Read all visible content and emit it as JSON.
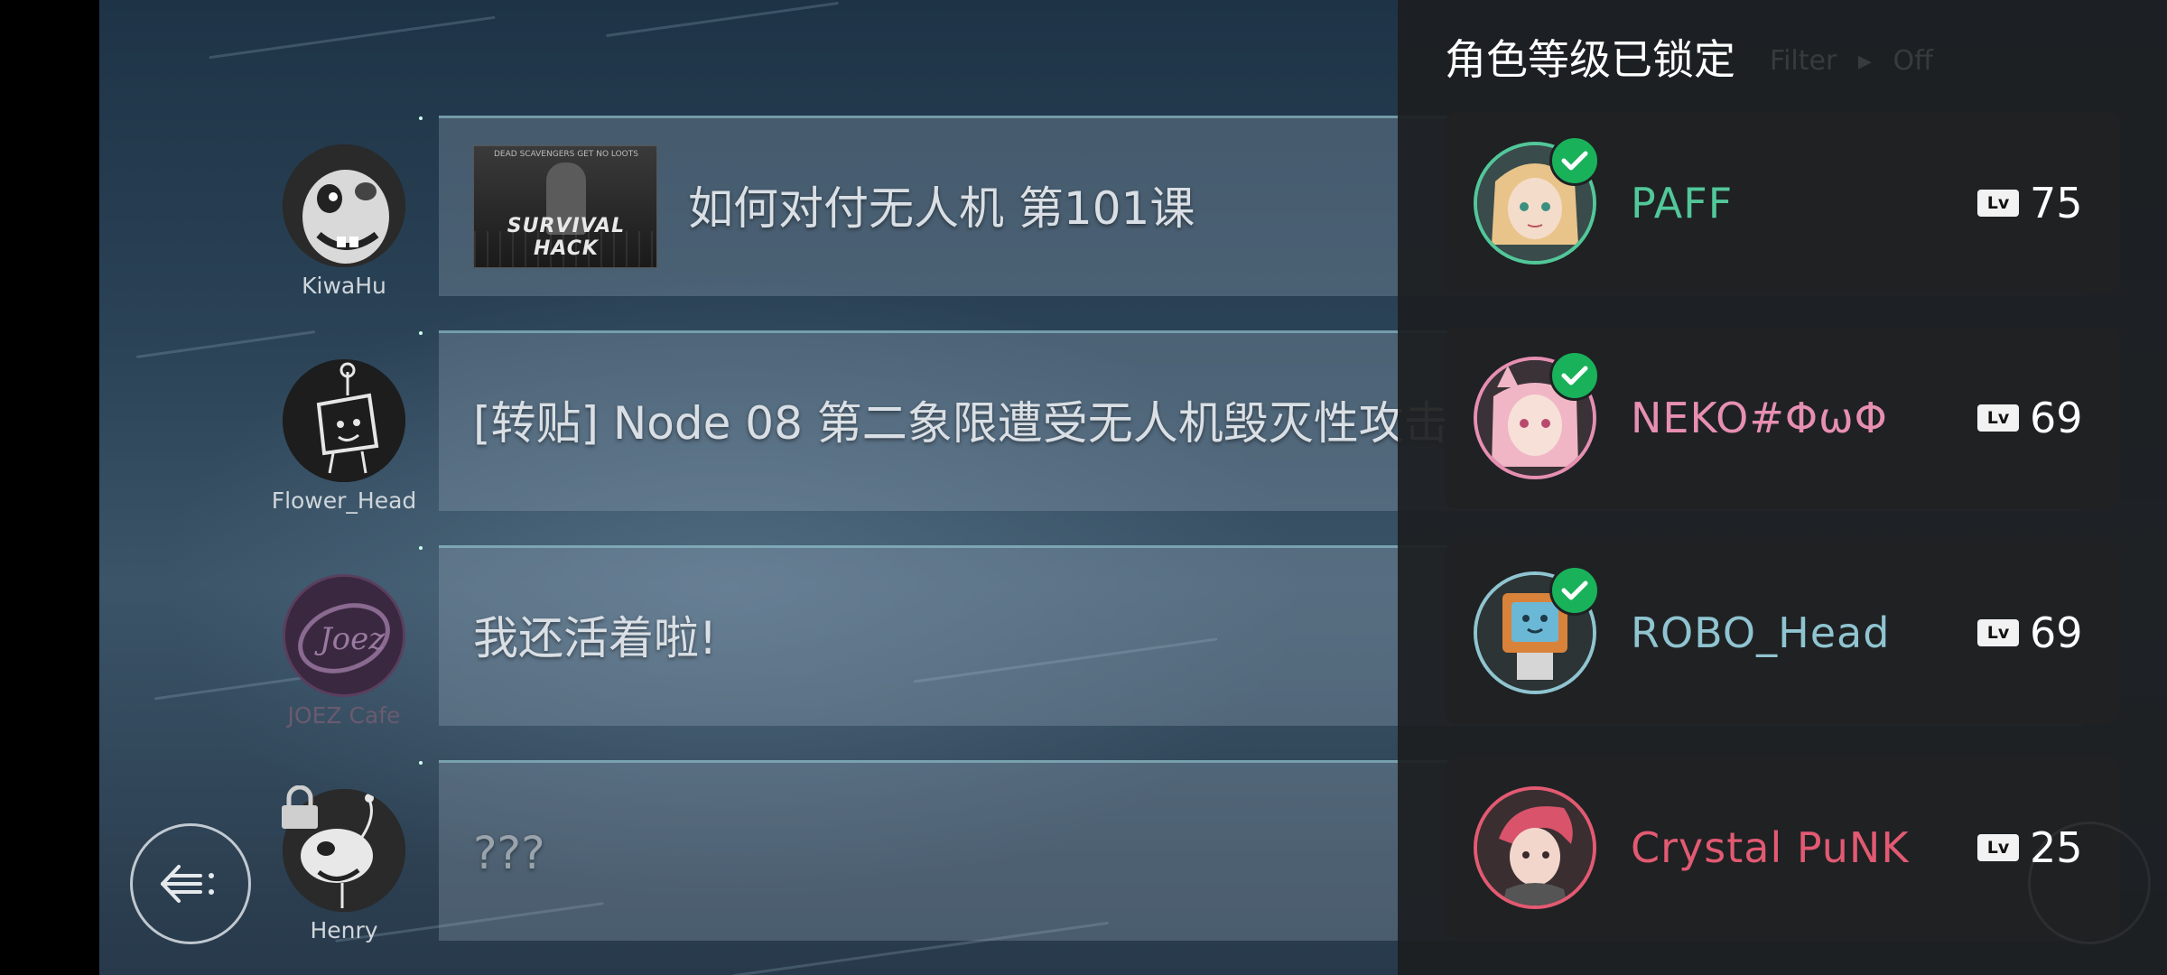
{
  "feed": {
    "posts": [
      {
        "author": "KiwaHu",
        "text": "如何对付无人机 第101课",
        "thumbnail": {
          "caption_small": "DEAD SCAVENGERS GET NO LOOTS",
          "caption_big": "SURVIVAL HACK"
        }
      },
      {
        "author": "Flower_Head",
        "text": "[转贴] Node 08 第二象限遭受无人机毁灭性攻击"
      },
      {
        "author": "JOEZ Cafe",
        "text": "我还活着啦!"
      },
      {
        "author": "Henry",
        "text": "???",
        "locked": true
      }
    ]
  },
  "background_panel": {
    "ghost_filter_label": "Filter",
    "ghost_filter_value": "Off"
  },
  "panel": {
    "title": "角色等级已锁定",
    "characters": [
      {
        "name": "PAFF",
        "level_badge": "Lv",
        "level": "75",
        "color": "#52c79a",
        "checked": true
      },
      {
        "name": "NEKO#ΦωΦ",
        "level_badge": "Lv",
        "level": "69",
        "color": "#e68fb1",
        "checked": true
      },
      {
        "name": "ROBO_Head",
        "level_badge": "Lv",
        "level": "69",
        "color": "#8fc4d0",
        "checked": true
      },
      {
        "name": "Crystal PuNK",
        "level_badge": "Lv",
        "level": "25",
        "color": "#e25a72",
        "checked": false
      }
    ]
  },
  "icons": {
    "back": "back-arrow-icon",
    "lock": "lock-icon",
    "check": "check-icon"
  },
  "colors": {
    "feed_divider": "#8fd0d8",
    "panel_bg": "#1c1e20",
    "check_green": "#19b25a"
  }
}
